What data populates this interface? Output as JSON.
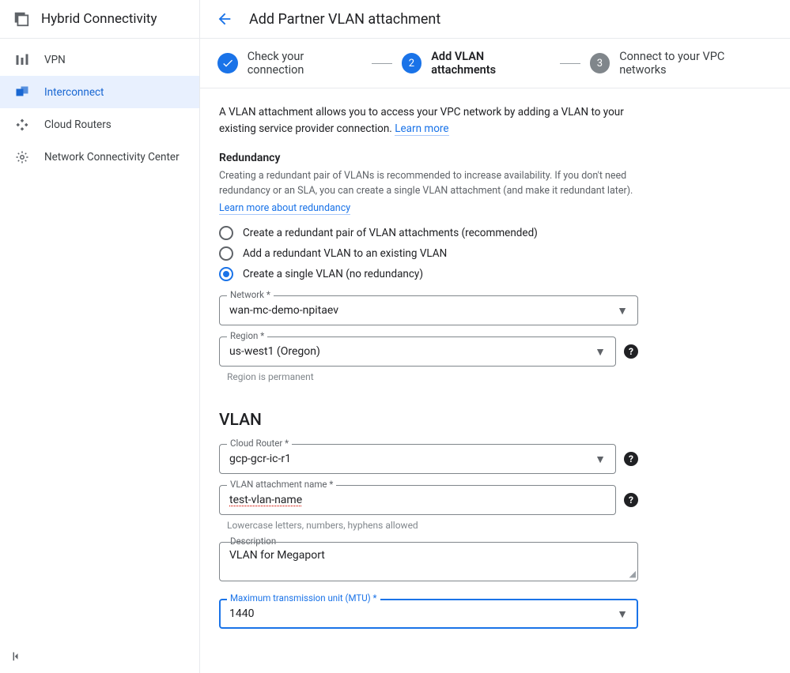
{
  "sidebar": {
    "title": "Hybrid Connectivity",
    "items": [
      {
        "label": "VPN"
      },
      {
        "label": "Interconnect"
      },
      {
        "label": "Cloud Routers"
      },
      {
        "label": "Network Connectivity Center"
      }
    ]
  },
  "header": {
    "title": "Add Partner VLAN attachment"
  },
  "stepper": {
    "step1": "Check your connection",
    "step2_num": "2",
    "step2": "Add VLAN attachments",
    "step3_num": "3",
    "step3": "Connect to your VPC networks"
  },
  "intro": {
    "text_a": "A VLAN attachment allows you to access your VPC network by adding a VLAN to your existing service provider connection. ",
    "learn_more": "Learn more"
  },
  "redundancy": {
    "heading": "Redundancy",
    "helper": "Creating a redundant pair of VLANs is recommended to increase availability. If you don't need redundancy or an SLA, you can create a single VLAN attachment (and make it redundant later).",
    "learn_more": "Learn more about redundancy",
    "option1": "Create a redundant pair of VLAN attachments (recommended)",
    "option2": "Add a redundant VLAN to an existing VLAN",
    "option3": "Create a single VLAN (no redundancy)"
  },
  "network": {
    "label": "Network *",
    "value": "wan-mc-demo-npitaev"
  },
  "region": {
    "label": "Region *",
    "value": "us-west1 (Oregon)",
    "helper": "Region is permanent"
  },
  "vlan_section": {
    "title": "VLAN"
  },
  "cloud_router": {
    "label": "Cloud Router *",
    "value": "gcp-gcr-ic-r1"
  },
  "attachment_name": {
    "label": "VLAN attachment name *",
    "value": "test-vlan-name",
    "helper": "Lowercase letters, numbers, hyphens allowed"
  },
  "description": {
    "label": "Description",
    "value_a": "VLAN for ",
    "value_b": "Megaport"
  },
  "mtu": {
    "label": "Maximum transmission unit (MTU) *",
    "value": "1440"
  }
}
